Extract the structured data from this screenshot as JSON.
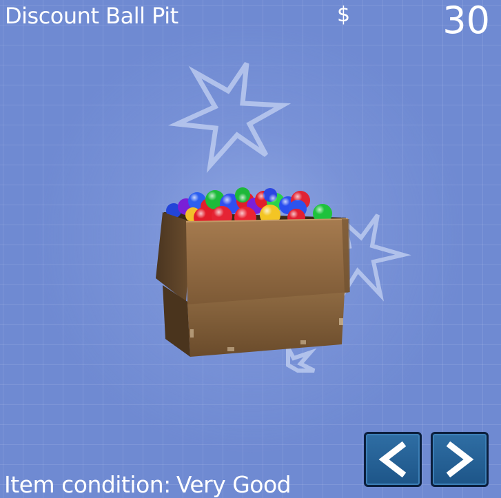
{
  "item": {
    "name": "Discount Ball Pit",
    "currency_symbol": "$",
    "price": "30",
    "condition_label": "Item condition:",
    "condition_value": "Very Good"
  },
  "icons": {
    "previous": "chevron-left-icon",
    "next": "chevron-right-icon",
    "decoration": "star-outline-icon"
  },
  "colors": {
    "background": "#6f8ad2",
    "button": "#1d5588",
    "button_border": "#0b1f3d",
    "text": "#ffffff"
  }
}
